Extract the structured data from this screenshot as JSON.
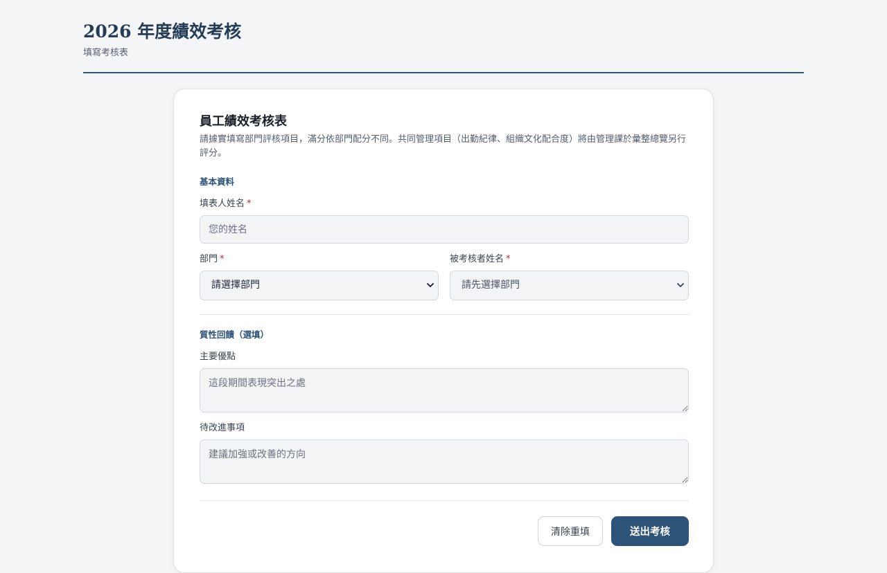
{
  "header": {
    "title": "2026 年度績效考核",
    "subtitle": "填寫考核表"
  },
  "form": {
    "title": "員工績效考核表",
    "description": "請據實填寫部門評核項目，滿分依部門配分不同。共同管理項目（出勤紀律、組織文化配合度）將由管理課於彙整總覽另行評分。",
    "basic_section": {
      "title": "基本資料",
      "filler_name": {
        "label": "填表人姓名",
        "required_mark": "*",
        "placeholder": "您的姓名",
        "value": ""
      },
      "department": {
        "label": "部門",
        "required_mark": "*",
        "selected": "請選擇部門"
      },
      "reviewee": {
        "label": "被考核者姓名",
        "required_mark": "*",
        "selected": "請先選擇部門"
      }
    },
    "feedback_section": {
      "title": "質性回饋（選填）",
      "strengths": {
        "label": "主要優點",
        "placeholder": "這段期間表現突出之處"
      },
      "improvements": {
        "label": "待改進事項",
        "placeholder": "建議加強或改善的方向"
      }
    },
    "actions": {
      "reset_label": "清除重填",
      "submit_label": "送出考核"
    }
  }
}
